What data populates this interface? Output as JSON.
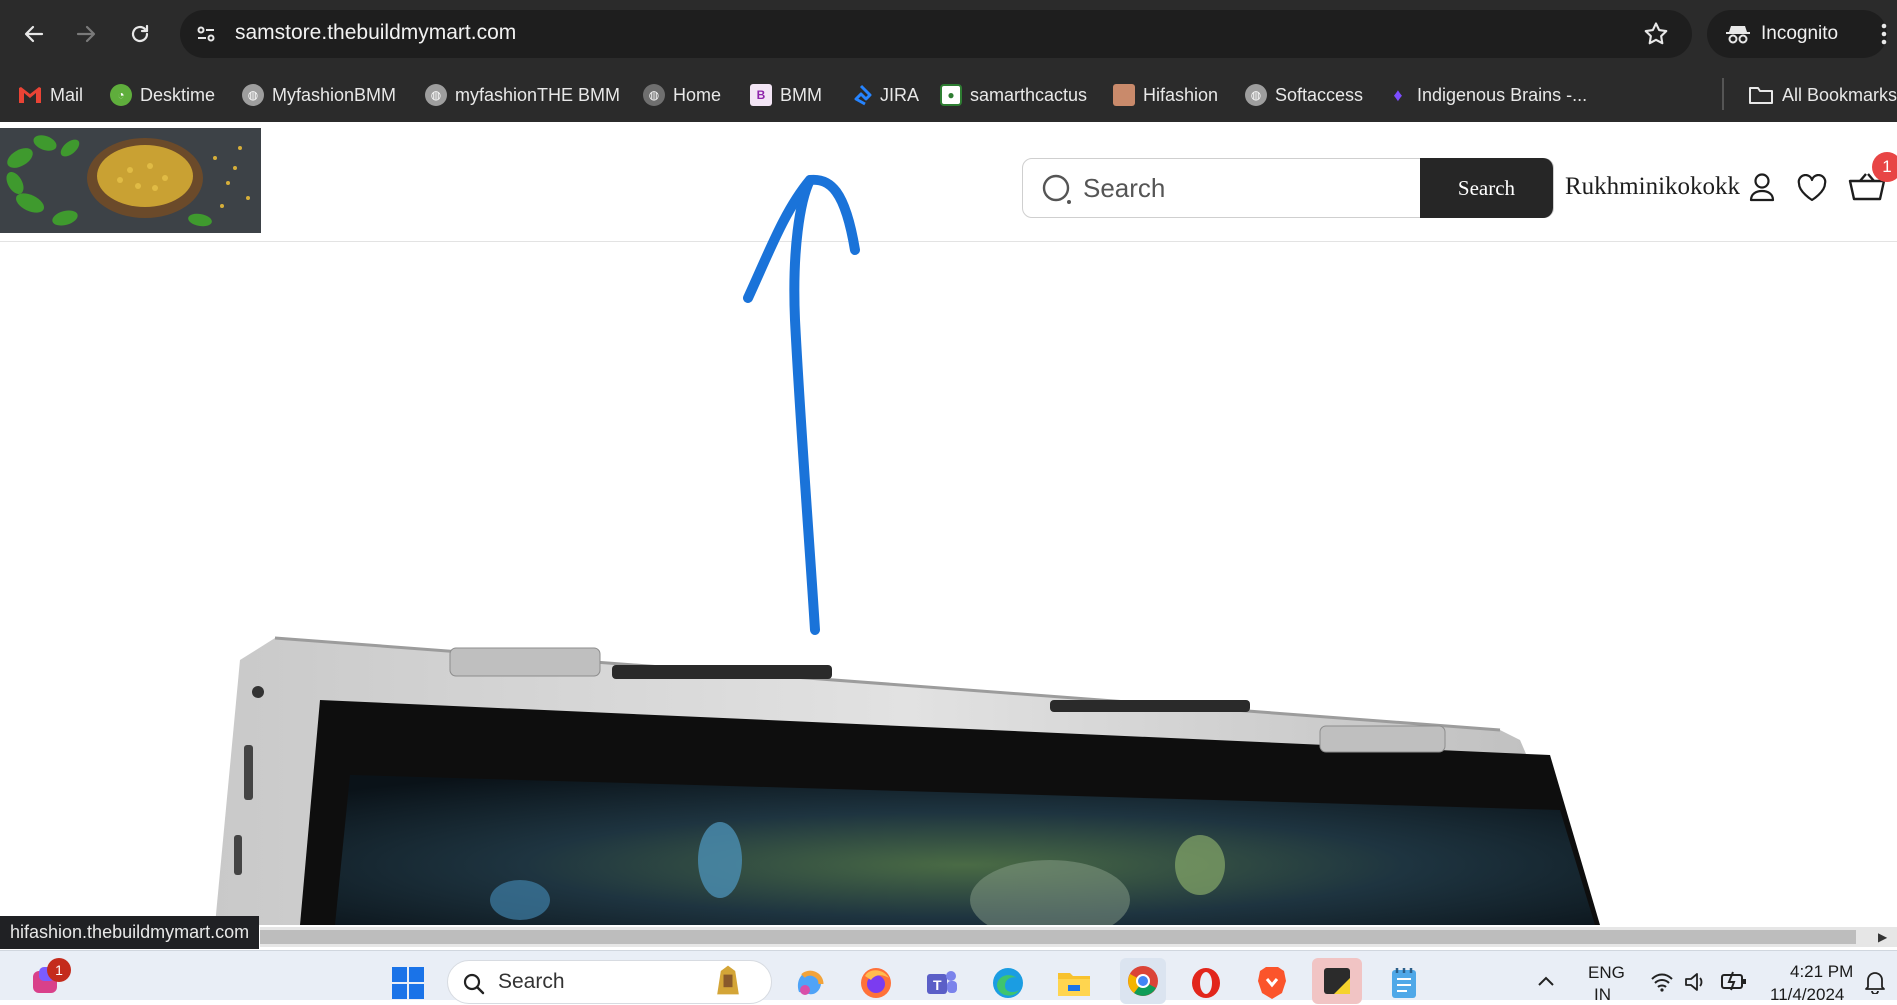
{
  "browser": {
    "url": "samstore.thebuildmymart.com",
    "incognito_label": "Incognito",
    "bookmarks": [
      {
        "label": "Mail",
        "icon": "gmail-icon"
      },
      {
        "label": "Desktime",
        "icon": "desktime-icon"
      },
      {
        "label": "MyfashionBMM",
        "icon": "globe-icon"
      },
      {
        "label": "myfashionTHE BMM",
        "icon": "globe-icon"
      },
      {
        "label": "Home",
        "icon": "globe-icon"
      },
      {
        "label": "BMM",
        "icon": "bmm-icon"
      },
      {
        "label": "JIRA",
        "icon": "jira-icon"
      },
      {
        "label": "samarthcactus",
        "icon": "samarth-icon"
      },
      {
        "label": "Hifashion",
        "icon": "hifashion-icon"
      },
      {
        "label": "Softaccess",
        "icon": "globe-icon"
      },
      {
        "label": "Indigenous Brains -...",
        "icon": "indigenous-icon"
      }
    ],
    "all_bookmarks_label": "All Bookmarks",
    "status_url": "hifashion.thebuildmymart.com"
  },
  "header": {
    "search_placeholder": "Search",
    "search_button": "Search",
    "user_name": "Rukhminikokokk",
    "cart_count": "1"
  },
  "taskbar": {
    "search_placeholder": "Search",
    "notification_count": "1",
    "lang_line1": "ENG",
    "lang_line2": "IN",
    "time": "4:21 PM",
    "date": "11/4/2024"
  },
  "colors": {
    "chrome_bg": "#2b2b2b",
    "search_button_bg": "#262626",
    "badge_red": "#e84545",
    "annotation_arrow": "#1a73d9"
  }
}
